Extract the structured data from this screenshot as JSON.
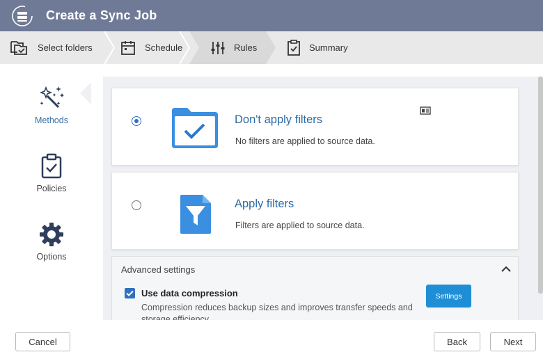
{
  "window": {
    "title": "Create a Sync Job"
  },
  "steps": [
    {
      "label": "Select folders",
      "icon": "folders-icon"
    },
    {
      "label": "Schedule",
      "icon": "calendar-icon"
    },
    {
      "label": "Rules",
      "icon": "sliders-icon",
      "active": true
    },
    {
      "label": "Summary",
      "icon": "clipboard-icon"
    }
  ],
  "leftnav": {
    "items": [
      {
        "label": "Methods",
        "icon": "magic-wand-icon",
        "active": true
      },
      {
        "label": "Policies",
        "icon": "clipboard-check-icon"
      },
      {
        "label": "Options",
        "icon": "gear-icon"
      }
    ]
  },
  "options": [
    {
      "title": "Don't apply filters",
      "desc": "No filters are applied to source data.",
      "selected": true,
      "icon": "folder-check-icon"
    },
    {
      "title": "Apply filters",
      "desc": "Filters are applied to source data.",
      "selected": false,
      "icon": "filter-icon"
    }
  ],
  "advanced": {
    "title": "Advanced settings",
    "compression_label": "Use data compression",
    "compression_checked": true,
    "compression_desc": "Compression reduces backup sizes and improves transfer speeds and storage efficiency.",
    "settings_label": "Settings"
  },
  "footer": {
    "cancel_label": "Cancel",
    "back_label": "Back",
    "next_label": "Next"
  },
  "colors": {
    "titlebar": "#6f7a97",
    "accent": "#2f6fbf",
    "link": "#2b6aa8",
    "button": "#1e8fd6"
  }
}
